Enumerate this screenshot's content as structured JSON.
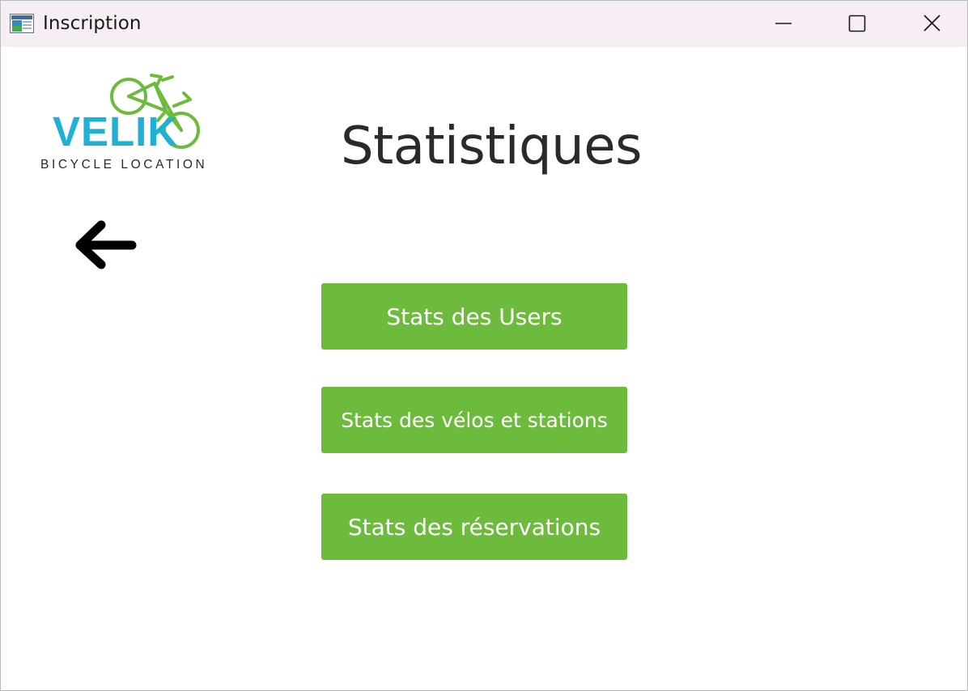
{
  "window": {
    "title": "Inscription",
    "icons": {
      "app": "app-window-icon",
      "minimize": "minimize-icon",
      "maximize": "maximize-icon",
      "close": "close-icon"
    }
  },
  "logo": {
    "brand": "VELIK",
    "tagline": "BICYCLE LOCATION",
    "icon": "bicycle-icon",
    "colors": {
      "brand_text": "#1fb0d6",
      "bike": "#6cbb3c"
    }
  },
  "page": {
    "title": "Statistiques",
    "back_icon": "arrow-left-icon"
  },
  "buttons": [
    {
      "label": "Stats des Users"
    },
    {
      "label": "Stats des vélos et stations"
    },
    {
      "label": "Stats des réservations"
    }
  ],
  "colors": {
    "button_bg": "#6cbb3c",
    "button_text": "#ffffff",
    "titlebar_bg": "#f6eef4"
  }
}
